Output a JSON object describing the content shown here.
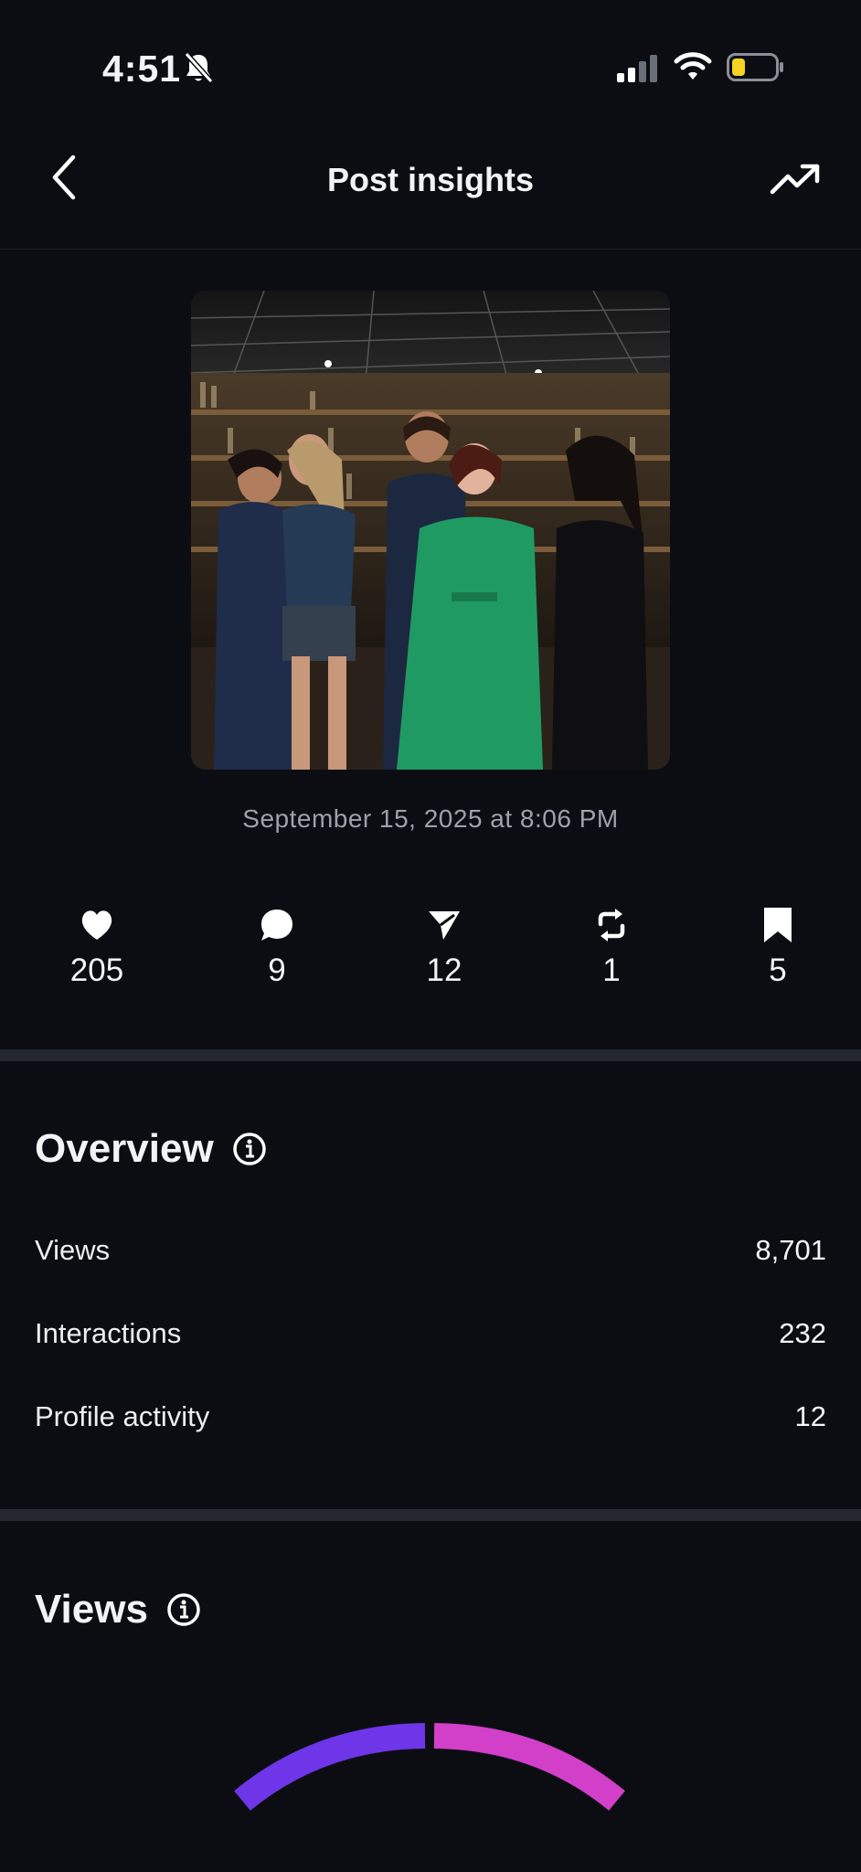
{
  "status_bar": {
    "time": "4:51"
  },
  "nav": {
    "title": "Post insights"
  },
  "post": {
    "date": "September 15, 2025 at 8:06 PM"
  },
  "metrics": [
    {
      "icon": "heart-icon",
      "value": "205"
    },
    {
      "icon": "comment-icon",
      "value": "9"
    },
    {
      "icon": "send-icon",
      "value": "12"
    },
    {
      "icon": "repost-icon",
      "value": "1"
    },
    {
      "icon": "bookmark-icon",
      "value": "5"
    }
  ],
  "overview": {
    "title": "Overview",
    "rows": [
      {
        "label": "Views",
        "value": "8,701"
      },
      {
        "label": "Interactions",
        "value": "232"
      },
      {
        "label": "Profile activity",
        "value": "12"
      }
    ]
  },
  "views_section": {
    "title": "Views"
  },
  "colors": {
    "background": "#0b0d12",
    "divider": "#24272e",
    "gauge_left": "#6f35e8",
    "gauge_right": "#d23fc9",
    "battery": "#f5d320"
  }
}
